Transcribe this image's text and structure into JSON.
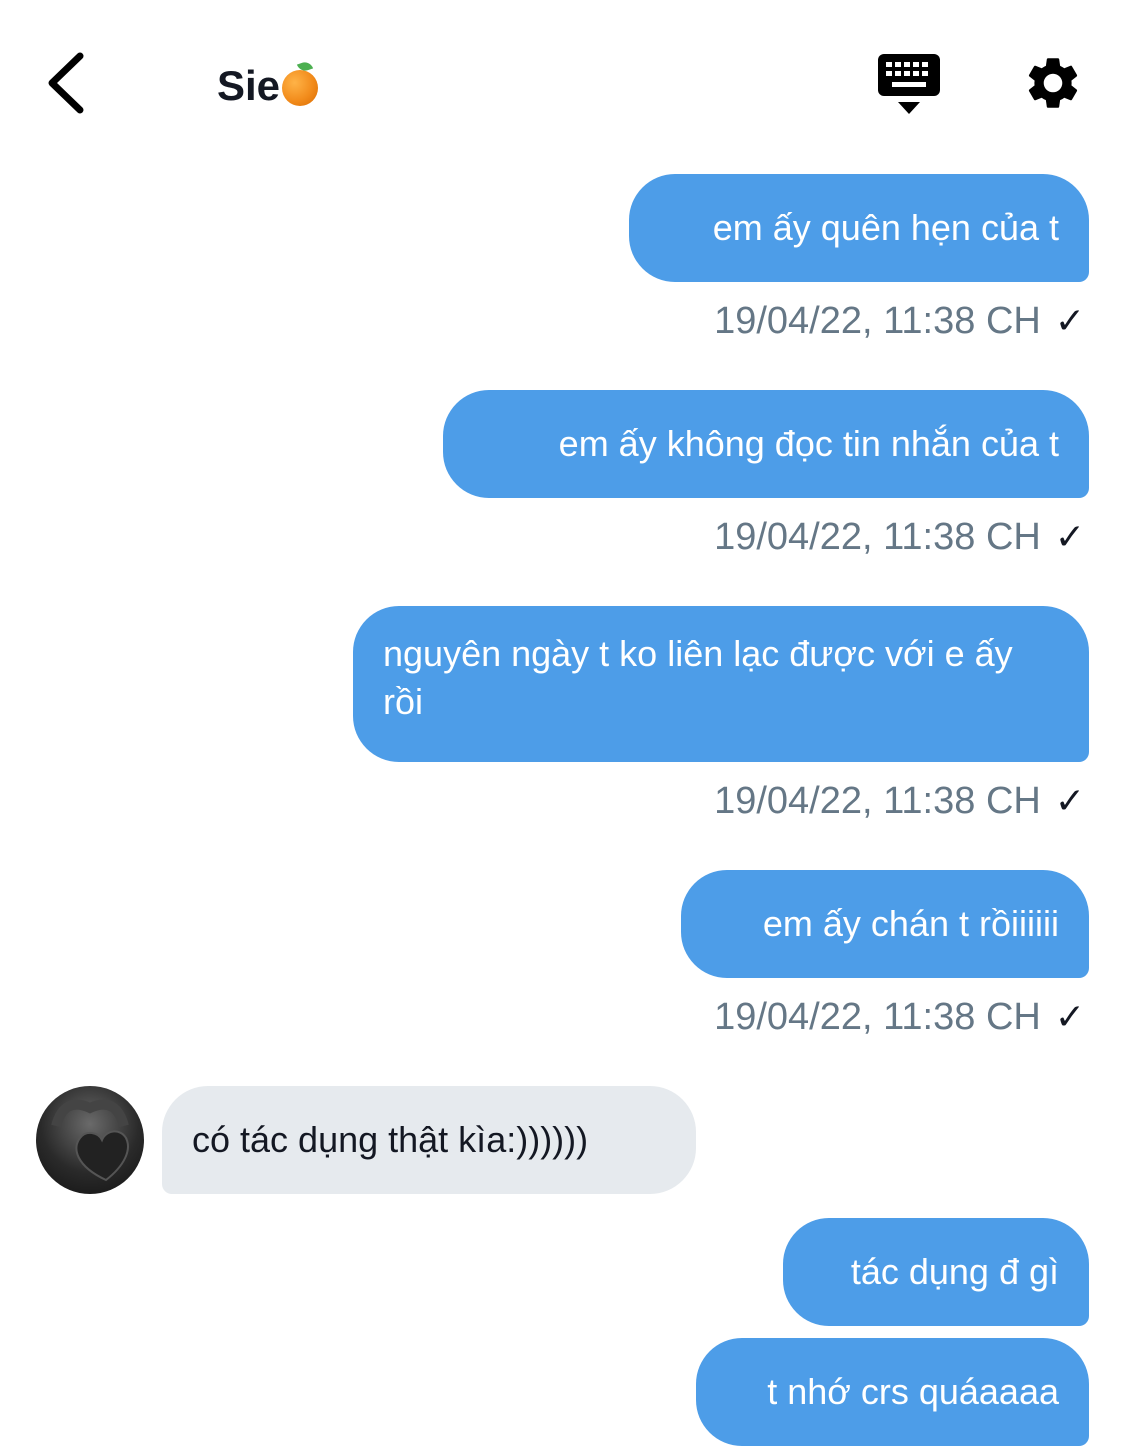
{
  "header": {
    "title": "Sie",
    "title_emoji": "orange-emoji",
    "back_icon": "chevron-left-icon",
    "keyboard_icon": "keyboard-icon",
    "settings_icon": "gear-icon"
  },
  "messages": [
    {
      "direction": "out",
      "text": "em ấy quên hẹn của t",
      "meta": "19/04/22, 11:38 CH"
    },
    {
      "direction": "out",
      "text": "em ấy không đọc tin nhắn của t",
      "meta": "19/04/22, 11:38 CH"
    },
    {
      "direction": "out",
      "text": "nguyên ngày t ko liên lạc được với e ấy rồi",
      "meta": "19/04/22, 11:38 CH"
    },
    {
      "direction": "out",
      "text": "em ấy chán t rồiiiiii",
      "meta": "19/04/22, 11:38 CH"
    },
    {
      "direction": "in",
      "text": "có tác dụng thật kìa:))))))"
    },
    {
      "direction": "out",
      "text": "tác dụng đ gì"
    },
    {
      "direction": "out",
      "text": "t nhớ crs quáaaaa"
    }
  ],
  "colors": {
    "outgoing_bubble": "#4d9de8",
    "incoming_bubble": "#e6eaee",
    "timestamp": "#657786"
  }
}
